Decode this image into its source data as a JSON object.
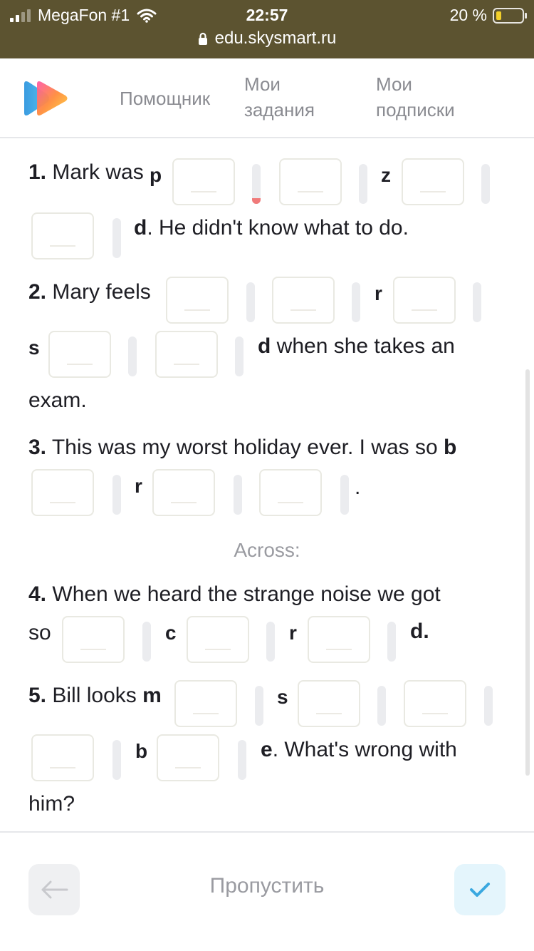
{
  "status": {
    "carrier": "MegaFon #1",
    "time": "22:57",
    "battery": "20 %",
    "url": "edu.skysmart.ru"
  },
  "nav": {
    "helper": "Помощник",
    "tasks": "Мои\nзадания",
    "subscriptions": "Мои\nподписки"
  },
  "exercise": {
    "q1": {
      "num": "1.",
      "text_a": "Mark was",
      "l1": "p",
      "l2": "z",
      "l3": "d",
      "end": ". He didn't know what to do."
    },
    "q2": {
      "num": "2.",
      "text_a": "Mary feels",
      "l1": "r",
      "l2": "s",
      "l3": "d",
      "end": " when she takes an",
      "tail": "exam."
    },
    "q3": {
      "num": "3.",
      "text_a": "This was my worst holiday ever. I was so",
      "l1": "b",
      "l2": "r",
      "end": "."
    },
    "across": "Across:",
    "q4": {
      "num": "4.",
      "text_a": "When we heard the strange noise we got",
      "text_b": "so",
      "l1": "c",
      "l2": "r",
      "l3": "d",
      "end": "."
    },
    "q5": {
      "num": "5.",
      "text_a": "Bill looks",
      "l1": "m",
      "l2": "s",
      "l3": "b",
      "l4": "e",
      "end": ". What's wrong with",
      "tail": "him?"
    }
  },
  "footer": {
    "skip": "Пропустить"
  },
  "colors": {
    "status_bar": "#5c5330",
    "accent_blue": "#3aa8e0",
    "error": "#f07a7a"
  }
}
